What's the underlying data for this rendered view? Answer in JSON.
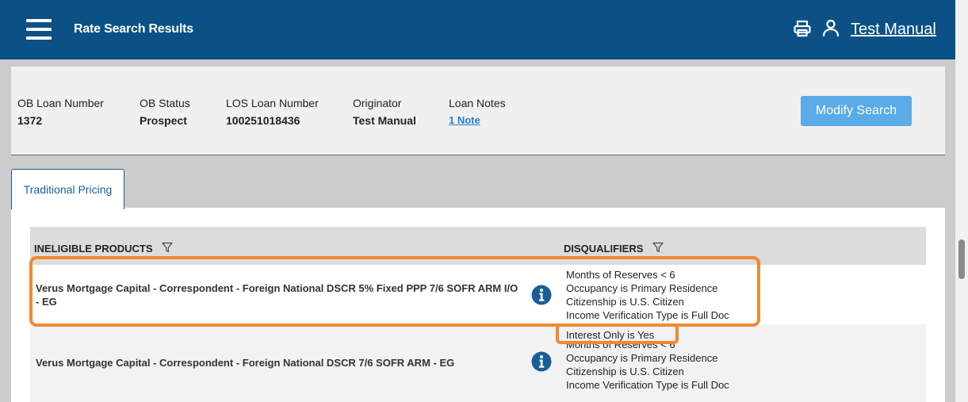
{
  "header": {
    "title": "Rate Search Results",
    "user_name": "Test Manual",
    "icons": [
      "hamburger-menu-icon",
      "print-icon",
      "user-icon"
    ]
  },
  "loan": {
    "ob_loan_number_label": "OB Loan Number",
    "ob_loan_number": "1372",
    "ob_status_label": "OB Status",
    "ob_status": "Prospect",
    "los_loan_number_label": "LOS Loan Number",
    "los_loan_number": "100251018436",
    "originator_label": "Originator",
    "originator": "Test Manual",
    "loan_notes_label": "Loan Notes",
    "loan_notes_link": "1 Note",
    "modify_button": "Modify Search"
  },
  "tabs": [
    {
      "label": "Traditional Pricing",
      "active": true
    }
  ],
  "table": {
    "columns": [
      "INELIGIBLE PRODUCTS",
      "DISQUALIFIERS"
    ],
    "rows": [
      {
        "product": "Verus Mortgage Capital - Correspondent - Foreign National DSCR 5% Fixed PPP 7/6 SOFR ARM I/O - EG",
        "disqualifiers": [
          "Months of Reserves < 6",
          "Occupancy is Primary Residence",
          "Citizenship is U.S. Citizen",
          "Income Verification Type is Full Doc"
        ]
      },
      {
        "product": "Verus Mortgage Capital - Correspondent - Foreign National DSCR 7/6 SOFR ARM - EG",
        "disqualifiers": [
          "Interest Only is Yes",
          "Months of Reserves < 6",
          "Occupancy is Primary Residence",
          "Citizenship is U.S. Citizen",
          "Income Verification Type is Full Doc"
        ]
      }
    ]
  },
  "colors": {
    "header_bg": "#0b5186",
    "button_bg": "#5aabe6",
    "highlight": "#ee8a32",
    "info_icon": "#1b5e97"
  }
}
